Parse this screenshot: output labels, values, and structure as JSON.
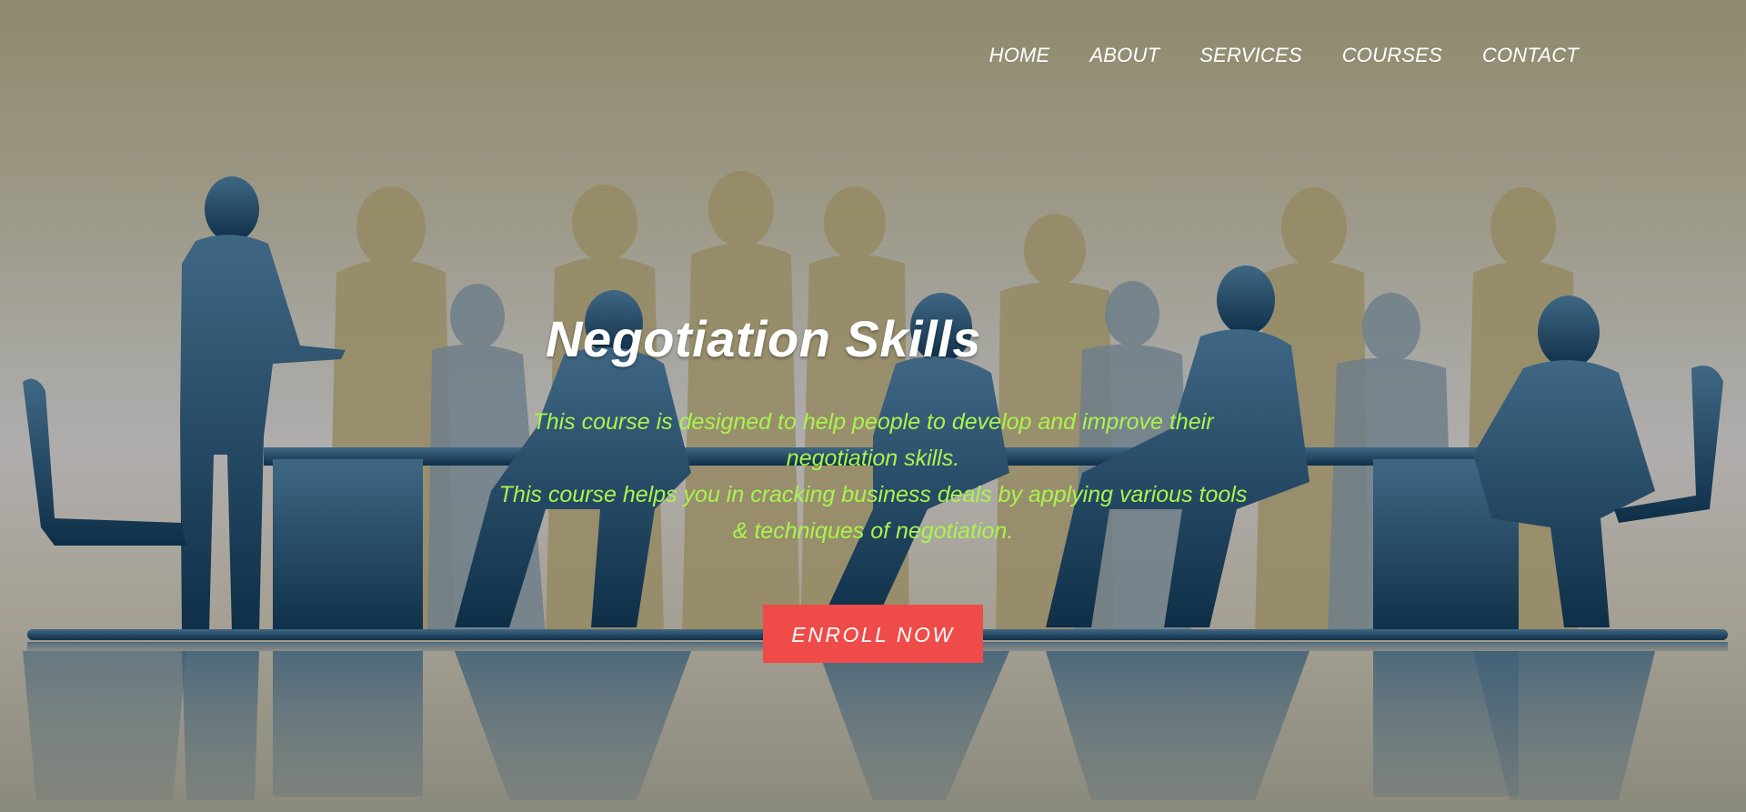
{
  "nav": {
    "items": [
      {
        "label": "HOME"
      },
      {
        "label": "ABOUT"
      },
      {
        "label": "SERVICES"
      },
      {
        "label": "COURSES"
      },
      {
        "label": "CONTACT"
      }
    ]
  },
  "hero": {
    "title": "Negotiation Skills",
    "description_line1": "This course is designed to help people to develop and improve their negotiation skills.",
    "description_line2": "This course helps you in cracking business deals by applying various tools & techniques of negotiation.",
    "cta_label": "ENROLL NOW",
    "colors": {
      "description_text": "#a9f44d",
      "cta_background": "#ef4b48",
      "title_text": "#ffffff",
      "silhouette_front": "#1f4a66",
      "silhouette_back": "#958a63"
    },
    "background_icon": "business-meeting-silhouette-illustration"
  }
}
